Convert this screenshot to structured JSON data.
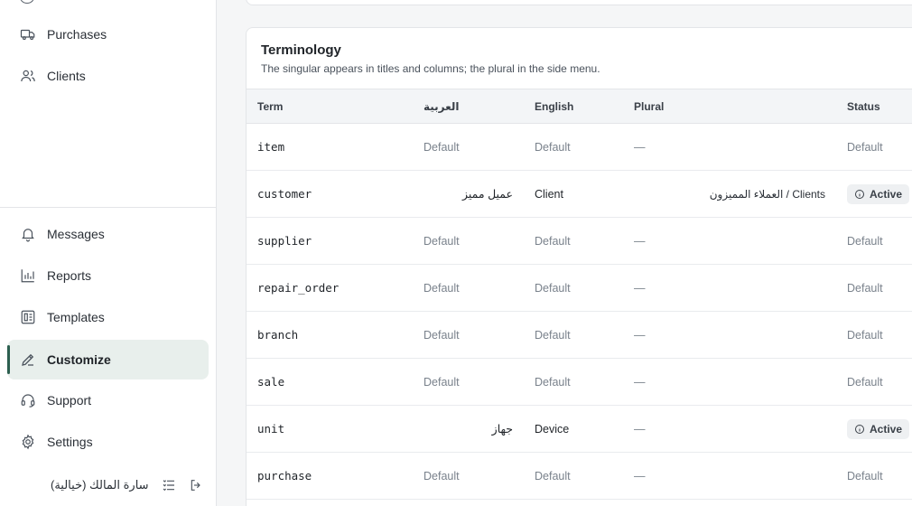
{
  "sidebar": {
    "items_top": [
      {
        "key": "purchases",
        "label": "Purchases",
        "icon": "truck-icon"
      },
      {
        "key": "clients",
        "label": "Clients",
        "icon": "users-icon"
      }
    ],
    "items_bottom": [
      {
        "key": "messages",
        "label": "Messages",
        "icon": "bell-icon"
      },
      {
        "key": "reports",
        "label": "Reports",
        "icon": "bar-chart-icon"
      },
      {
        "key": "templates",
        "label": "Templates",
        "icon": "template-icon"
      },
      {
        "key": "customize",
        "label": "Customize",
        "icon": "pencil-icon",
        "active": true
      },
      {
        "key": "support",
        "label": "Support",
        "icon": "headset-icon"
      },
      {
        "key": "settings",
        "label": "Settings",
        "icon": "gear-icon"
      }
    ],
    "user": {
      "name": "سارة المالك (خيالية)"
    }
  },
  "terminology": {
    "title": "Terminology",
    "subtitle": "The singular appears in titles and columns; the plural in the side menu.",
    "columns": {
      "term": "Term",
      "arabic": "العربية",
      "english": "English",
      "plural": "Plural",
      "status": "Status"
    },
    "rows": [
      {
        "term": "item",
        "arabic": "Default",
        "english": "Default",
        "plural": "—",
        "status": "Default",
        "custom": false
      },
      {
        "term": "customer",
        "arabic": "عميل مميز",
        "english": "Client",
        "plural": "العملاء المميزون / Clients",
        "status": "Active",
        "custom": true
      },
      {
        "term": "supplier",
        "arabic": "Default",
        "english": "Default",
        "plural": "—",
        "status": "Default",
        "custom": false
      },
      {
        "term": "repair_order",
        "arabic": "Default",
        "english": "Default",
        "plural": "—",
        "status": "Default",
        "custom": false
      },
      {
        "term": "branch",
        "arabic": "Default",
        "english": "Default",
        "plural": "—",
        "status": "Default",
        "custom": false
      },
      {
        "term": "sale",
        "arabic": "Default",
        "english": "Default",
        "plural": "—",
        "status": "Default",
        "custom": false
      },
      {
        "term": "unit",
        "arabic": "جهاز",
        "english": "Device",
        "plural": "—",
        "status": "Active",
        "custom": true
      },
      {
        "term": "purchase",
        "arabic": "Default",
        "english": "Default",
        "plural": "—",
        "status": "Default",
        "custom": false
      }
    ]
  },
  "colors": {
    "accent": "#2c5f4f",
    "active_bg": "#e8efec"
  }
}
